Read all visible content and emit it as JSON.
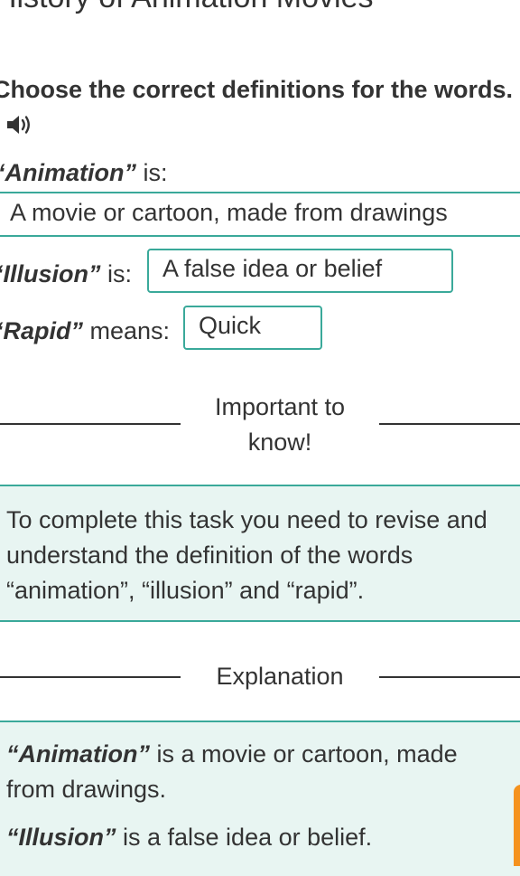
{
  "header": {
    "title": "History of Animation Movies"
  },
  "task": {
    "instruction": "Choose the correct definitions for the words.",
    "audio_icon": "speaker-icon"
  },
  "questions": [
    {
      "keyword": "“Animation”",
      "suffix": " is:",
      "answer": "A movie or cartoon, made from drawings"
    },
    {
      "keyword": "“Illusion”",
      "suffix": " is:",
      "answer": "A false idea or belief"
    },
    {
      "keyword": "“Rapid”",
      "suffix": " means:",
      "answer": "Quick"
    }
  ],
  "important": {
    "heading": "Important to know!",
    "lines": [
      "To complete this task you need to revise and",
      "understand the definition of the words",
      "“animation”, “illusion” and “rapid”."
    ]
  },
  "explanation": {
    "heading": "Explanation",
    "items": [
      {
        "keyword": "“Animation”",
        "rest_line1": " is a movie or cartoon, made",
        "rest_line2": "from drawings."
      },
      {
        "keyword": "“Illusion”",
        "rest_line1": " is a false idea or belief."
      }
    ]
  },
  "colors": {
    "accent": "#3aa99a",
    "panel_bg": "#e8f5f2",
    "orange_tab": "#f5921e",
    "text": "#333333"
  }
}
